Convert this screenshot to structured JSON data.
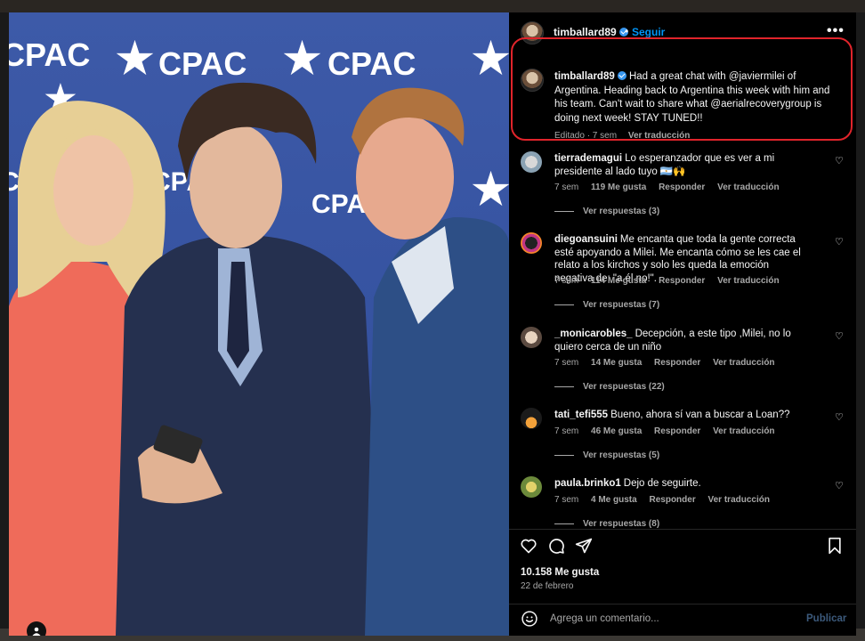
{
  "post": {
    "username": "timballard89",
    "follow_label": "Seguir",
    "dot": "•",
    "more_icon": "more-horizontal-icon",
    "photo_logos": [
      "CPAC",
      "CPAC",
      "CPAC",
      "CPAC",
      "CPAC",
      "CPAC"
    ],
    "caption": {
      "username": "timballard89",
      "text": "Had a great chat with @javiermilei of Argentina. Heading back to Argentina this week with him and his team. Can't wait to share what @aerialrecoverygroup is doing next week! STAY TUNED!!",
      "edited": "Editado · 7 sem",
      "translate": "Ver traducción"
    },
    "highlight_color": "#e0242b"
  },
  "comments": [
    {
      "username": "tierrademagui",
      "text": "Lo esperanzador que es ver a mi presidente al lado tuyo 🇦🇷🙌",
      "time": "7 sem",
      "likes": "119 Me gusta",
      "reply": "Responder",
      "translate": "Ver traducción",
      "replies": "Ver respuestas (3)"
    },
    {
      "username": "diegoansuini",
      "text": "Me encanta que toda la gente correcta esté apoyando a Milei. Me encanta cómo se les cae el relato a los kirchos y solo les queda la emoción negativa de: \"a él no!\".",
      "time": "7 sem",
      "likes": "114 Me gusta",
      "reply": "Responder",
      "translate": "Ver traducción",
      "replies": "Ver respuestas (7)"
    },
    {
      "username": "_monicarobles_",
      "text": "Decepción, a este tipo ,Milei, no lo quiero cerca de un niño",
      "time": "7 sem",
      "likes": "14 Me gusta",
      "reply": "Responder",
      "translate": "Ver traducción",
      "replies": "Ver respuestas (22)"
    },
    {
      "username": "tati_tefi555",
      "text": "Bueno, ahora sí van a buscar a Loan??",
      "time": "7 sem",
      "likes": "46 Me gusta",
      "reply": "Responder",
      "translate": "Ver traducción",
      "replies": "Ver respuestas (5)"
    },
    {
      "username": "paula.brinko1",
      "text": "Dejo de seguirte.",
      "time": "7 sem",
      "likes": "4 Me gusta",
      "reply": "Responder",
      "translate": "Ver traducción",
      "replies": "Ver respuestas (8)"
    }
  ],
  "footer": {
    "likes": "10.158 Me gusta",
    "date": "22 de febrero",
    "comment_placeholder": "Agrega un comentario...",
    "publish": "Publicar"
  },
  "icons": {
    "like": "heart-icon",
    "comment": "comment-icon",
    "share": "share-icon",
    "save": "bookmark-icon",
    "emoji": "emoji-icon",
    "user_tag": "user-tag-icon"
  }
}
